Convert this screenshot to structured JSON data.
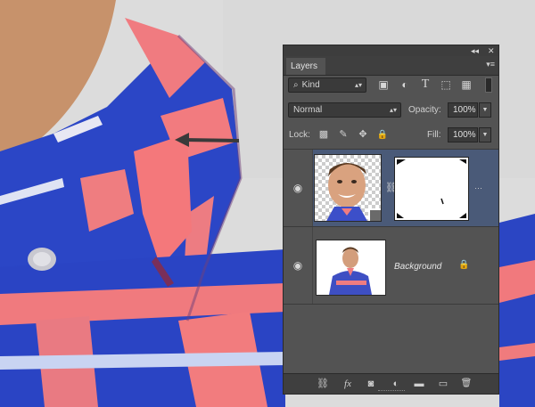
{
  "panel": {
    "collapse_glyph": "◂◂",
    "close_glyph": "✕",
    "tab_label": "Layers",
    "menu_glyph": "▾≡"
  },
  "filter": {
    "kind_label": "Kind",
    "search_glyph": "⌕",
    "icons": [
      "image-filter-icon",
      "adjustment-filter-icon",
      "type-filter-icon",
      "shape-filter-icon",
      "smart-object-filter-icon"
    ],
    "glyphs": {
      "image": "▣",
      "adjustment": "◐",
      "type": "T",
      "shape": "⬚",
      "smart": "▦"
    }
  },
  "blend": {
    "mode": "Normal",
    "opacity_label": "Opacity:",
    "opacity_value": "100%"
  },
  "lock": {
    "label": "Lock:",
    "glyphs": {
      "pixels": "▩",
      "paint": "✎",
      "position": "✥",
      "all": "🔒"
    },
    "fill_label": "Fill:",
    "fill_value": "100%"
  },
  "layers": [
    {
      "name": "",
      "has_mask": true,
      "selected": true,
      "more_glyph": "···"
    },
    {
      "name": "Background",
      "locked": true
    }
  ],
  "footer_icons": [
    "link-layers-icon",
    "fx-icon",
    "add-mask-icon",
    "adjustment-layer-icon",
    "new-group-icon",
    "new-layer-icon",
    "delete-layer-icon"
  ],
  "footer_glyphs": {
    "link": "⛓",
    "fx": "fx",
    "mask": "◙",
    "adjust": "◐",
    "group": "▬",
    "new": "▭",
    "delete": "🗑"
  },
  "colors": {
    "panel_bg": "#535353",
    "selected_row": "#4a5a78",
    "shirt_blue": "#2743c8",
    "shirt_pink": "#f27a7d",
    "skin": "#c8946a"
  }
}
